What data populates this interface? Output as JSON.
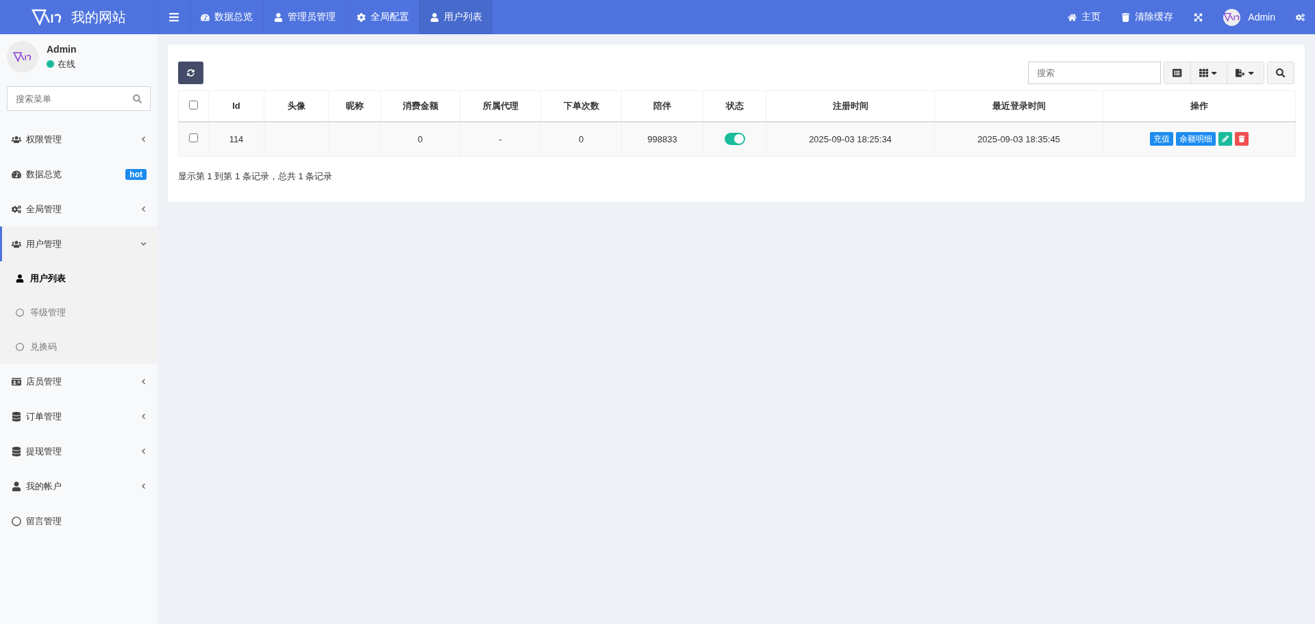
{
  "header": {
    "site_name": "我的网站",
    "nav_items": [
      {
        "label": "数据总览",
        "selected": false
      },
      {
        "label": "管理员管理",
        "selected": false
      },
      {
        "label": "全局配置",
        "selected": false
      },
      {
        "label": "用户列表",
        "selected": true
      }
    ],
    "right_items": [
      {
        "label": "主页"
      },
      {
        "label": "清除缓存"
      }
    ],
    "user_name": "Admin"
  },
  "sidebar": {
    "user": {
      "name": "Admin",
      "status": "在线"
    },
    "search": {
      "placeholder": "搜索菜单"
    },
    "menu": [
      {
        "label": "权限管理",
        "kind": "group",
        "expanded": false,
        "selected": false
      },
      {
        "label": "数据总览",
        "kind": "link",
        "selected": false,
        "badge": "hot"
      },
      {
        "label": "全局管理",
        "kind": "group",
        "expanded": false,
        "selected": false
      },
      {
        "label": "用户管理",
        "kind": "group",
        "expanded": true,
        "selected": true,
        "children": [
          {
            "label": "用户列表",
            "selected": true
          },
          {
            "label": "等级管理",
            "selected": false
          },
          {
            "label": "兑换码",
            "selected": false
          }
        ]
      },
      {
        "label": "店员管理",
        "kind": "group",
        "expanded": false,
        "selected": false
      },
      {
        "label": "订单管理",
        "kind": "group",
        "expanded": false,
        "selected": false
      },
      {
        "label": "提现管理",
        "kind": "group",
        "expanded": false,
        "selected": false
      },
      {
        "label": "我的帐户",
        "kind": "group",
        "expanded": false,
        "selected": false
      },
      {
        "label": "留言管理",
        "kind": "link",
        "selected": false
      }
    ]
  },
  "toolbar": {
    "search": {
      "placeholder": "搜索"
    }
  },
  "table": {
    "header_checked": false,
    "columns": [
      "Id",
      "头像",
      "昵称",
      "消费金额",
      "所属代理",
      "下单次数",
      "陪伴",
      "状态",
      "注册时间",
      "最近登录时间",
      "操作"
    ],
    "rows": [
      {
        "checked": false,
        "id": "114",
        "avatar": "",
        "nickname": "",
        "spent": "0",
        "agent": "-",
        "orders": "0",
        "companion": "998833",
        "status_on": true,
        "registered": "2025-09-03 18:25:34",
        "last_login": "2025-09-03 18:35:45",
        "actions": [
          "充值",
          "余额明细"
        ]
      }
    ]
  },
  "pagination_info": "显示第 1 到第 1 条记录，总共 1 条记录"
}
